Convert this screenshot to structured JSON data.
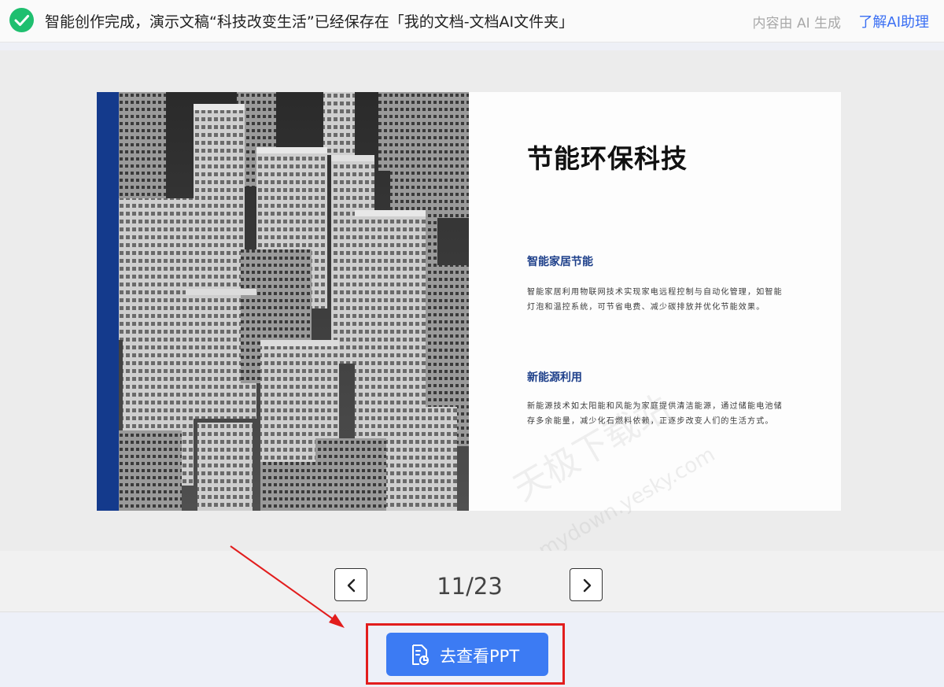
{
  "notification": {
    "message": "智能创作完成，演示文稿“科技改变生活”已经保存在「我的文档-文档AI文件夹」",
    "ai_note": "内容由 AI 生成",
    "ai_link": "了解AI助理",
    "status_icon": "check-circle-icon",
    "accent_color": "#1fbf6f"
  },
  "slide": {
    "title": "节能环保科技",
    "sections": [
      {
        "heading": "智能家居节能",
        "body": "智能家居利用物联网技术实现家电远程控制与自动化管理，如智能灯泡和温控系统，可节省电费、减少碳排放并优化节能效果。"
      },
      {
        "heading": "新能源利用",
        "body": "新能源技术如太阳能和风能为家庭提供清洁能源，通过储能电池储存多余能量，减少化石燃料依赖，正逐步改变人们的生活方式。"
      }
    ],
    "watermark": "天极下载站",
    "watermark_url": "mydown.yesky.com",
    "bar_color": "#143a8c"
  },
  "pager": {
    "current": 11,
    "total": 23,
    "label": "11/23"
  },
  "action": {
    "view_button_label": "去查看PPT",
    "button_color": "#3c7bf3",
    "highlight_color": "#e21d1d"
  }
}
